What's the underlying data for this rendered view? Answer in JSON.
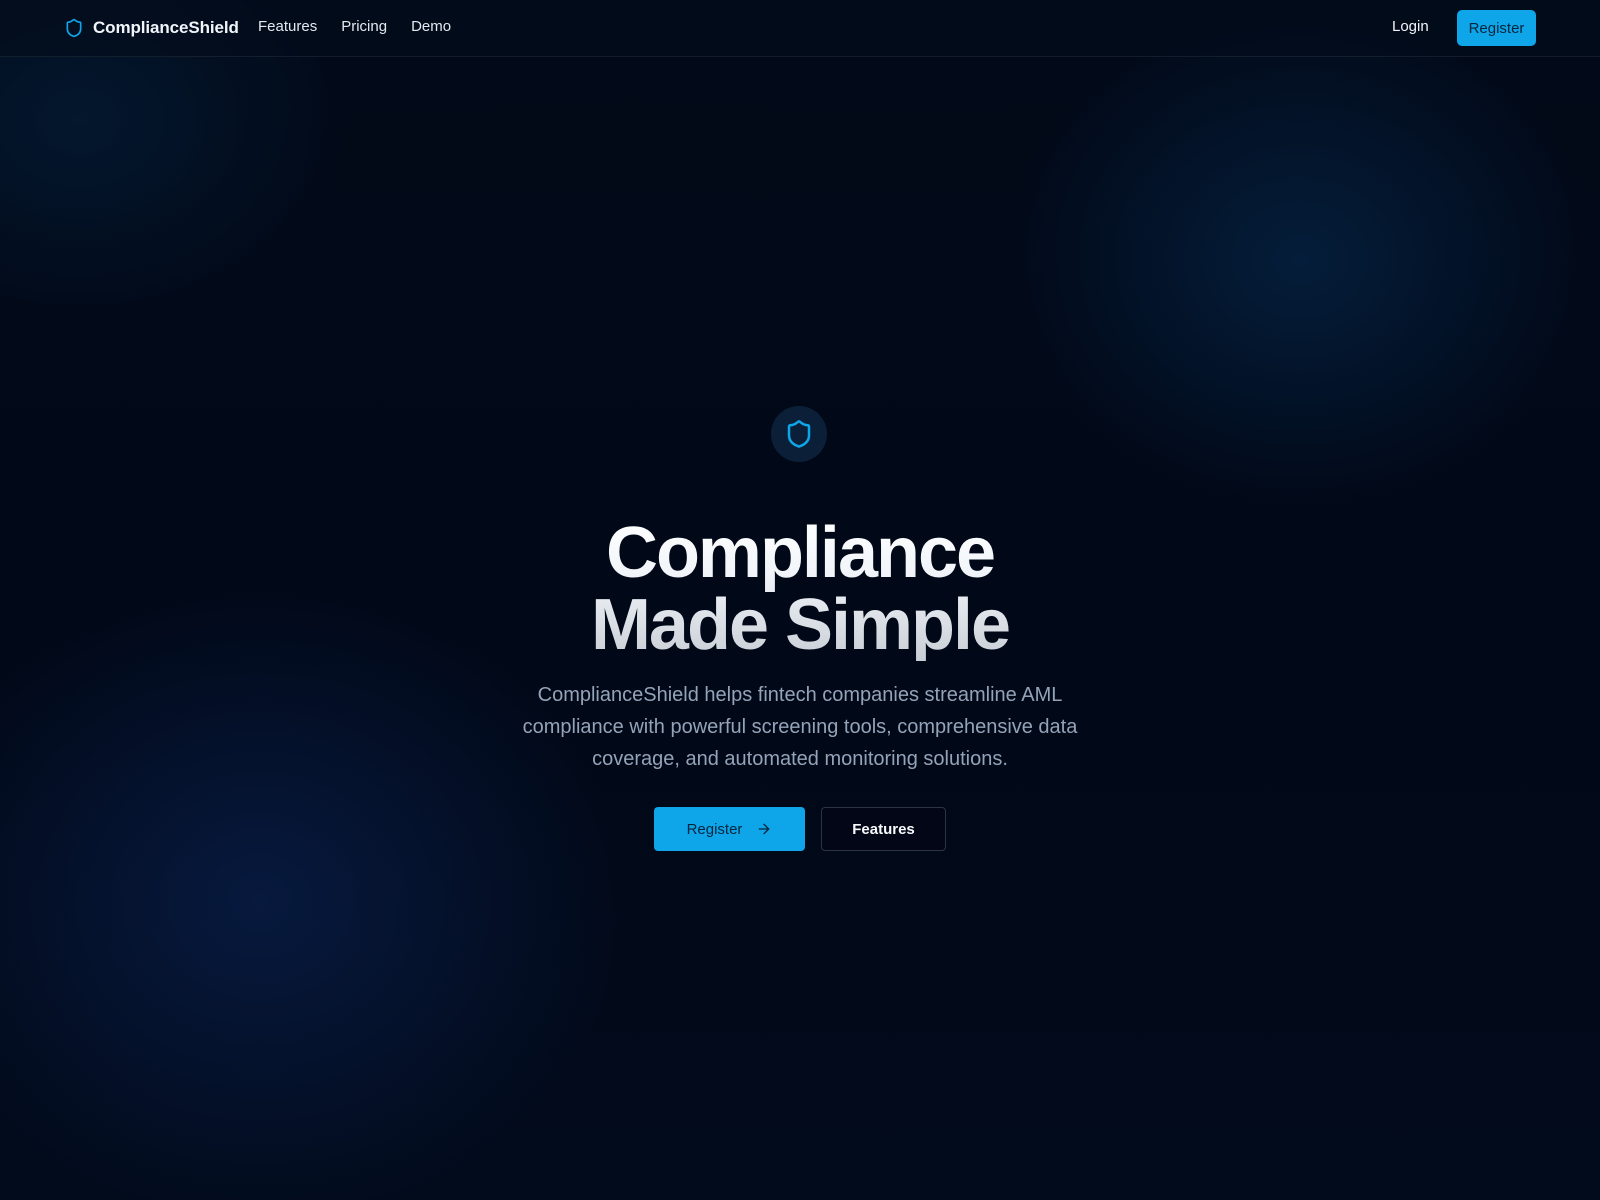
{
  "header": {
    "brand": {
      "name": "ComplianceShield",
      "icon": "shield-icon"
    },
    "nav": [
      {
        "label": "Features"
      },
      {
        "label": "Pricing"
      },
      {
        "label": "Demo"
      }
    ],
    "login_label": "Login",
    "register_label": "Register"
  },
  "hero": {
    "badge_icon": "shield-icon",
    "title_line1": "Compliance",
    "title_line2": "Made Simple",
    "subtitle": "ComplianceShield helps fintech companies streamline AML compliance with powerful screening tools, comprehensive data coverage, and automated monitoring solutions.",
    "primary_cta": {
      "label": "Register",
      "icon": "arrow-right-icon"
    },
    "secondary_cta": {
      "label": "Features"
    }
  },
  "colors": {
    "accent": "#0ea5e9",
    "background": "#020817",
    "text_muted": "#94a3b8"
  }
}
